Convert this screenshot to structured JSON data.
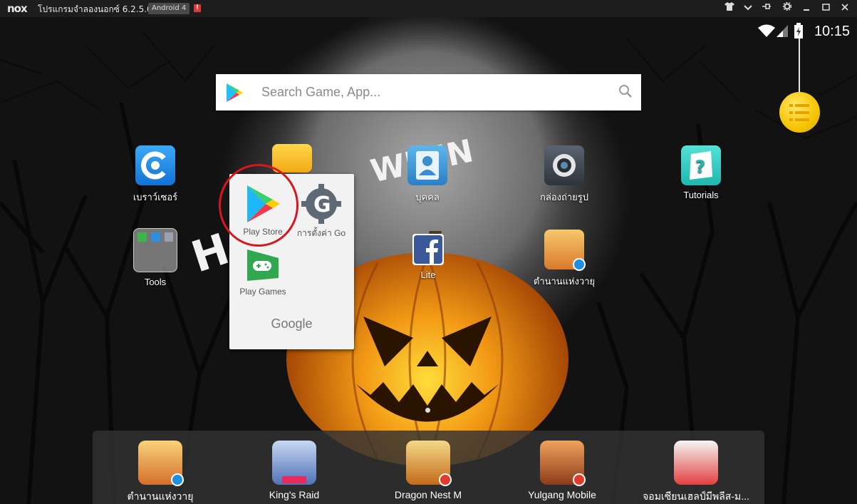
{
  "titlebar": {
    "logo": "nox",
    "title": "โปรแกรมจำลองนอกซ์ 6.2.5.0",
    "android_badge": "Android 4",
    "warning": "!",
    "buttons": [
      "shirt-icon",
      "chevron-down-icon",
      "pin-icon",
      "gear-icon",
      "minimize-icon",
      "maximize-icon",
      "close-icon"
    ]
  },
  "status": {
    "time": "10:15"
  },
  "search": {
    "placeholder": "Search Game, App..."
  },
  "desktop": {
    "browser": "เบราว์เซอร์",
    "contacts": "บุคคล",
    "camera": "กล่องถ่ายรูป",
    "tutorials": "Tutorials",
    "tools": "Tools",
    "fb_lite": "Lite",
    "game1": "ตำนานแห่งวายุ"
  },
  "folder": {
    "name": "Google",
    "items": [
      "Play Store",
      "การตั้งค่า Go",
      "Play Games"
    ]
  },
  "dock": {
    "apps": [
      "ตำนานแห่งวายุ",
      "King's Raid",
      "Dragon Nest M",
      "Yulgang Mobile",
      "จอมเซียนเฮลป์มีพลีส-ม..."
    ]
  },
  "colors": {
    "accent_red": "#d8171d",
    "play_green": "#34a853",
    "list_yellow": "#f5c400"
  }
}
